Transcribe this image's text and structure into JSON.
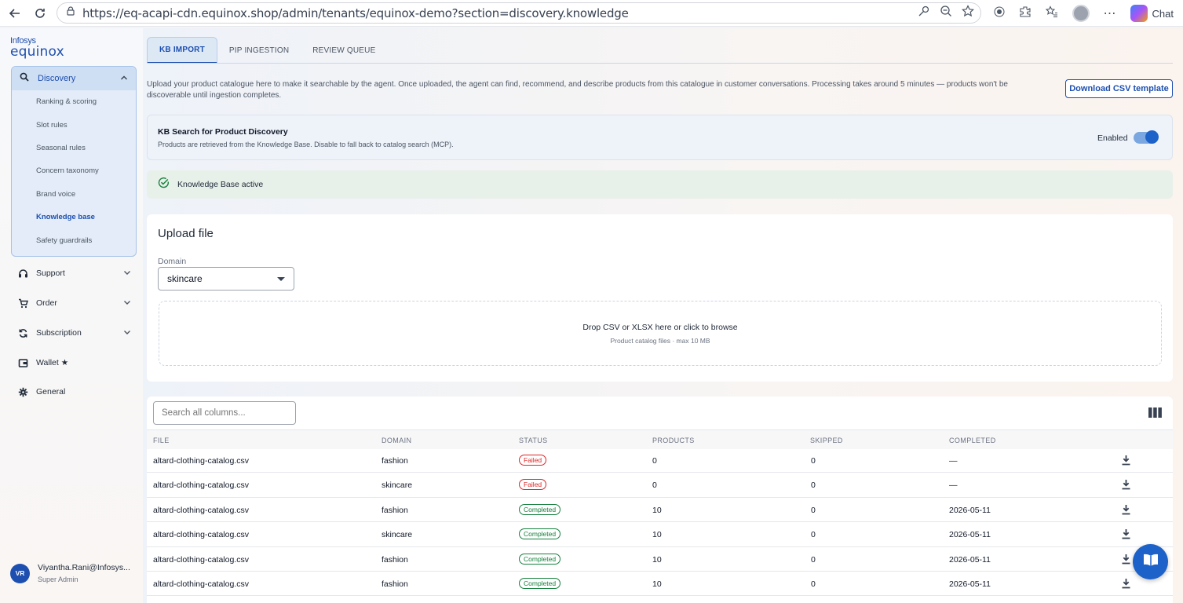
{
  "browser": {
    "url": "https://eq-acapi-cdn.equinox.shop/admin/tenants/equinox-demo?section=discovery.knowledge",
    "chat_label": "Chat"
  },
  "logo": {
    "top": "Infosys",
    "main": "equinox"
  },
  "sidebar": {
    "discovery": {
      "label": "Discovery",
      "items": [
        {
          "label": "Ranking & scoring",
          "active": false
        },
        {
          "label": "Slot rules",
          "active": false
        },
        {
          "label": "Seasonal rules",
          "active": false
        },
        {
          "label": "Concern taxonomy",
          "active": false
        },
        {
          "label": "Brand voice",
          "active": false
        },
        {
          "label": "Knowledge base",
          "active": true
        },
        {
          "label": "Safety guardrails",
          "active": false
        }
      ]
    },
    "nav": [
      {
        "label": "Support",
        "icon": "headset-icon"
      },
      {
        "label": "Order",
        "icon": "cart-icon"
      },
      {
        "label": "Subscription",
        "icon": "refresh-icon"
      },
      {
        "label": "Wallet ★",
        "icon": "wallet-icon"
      },
      {
        "label": "General",
        "icon": "gear-icon"
      }
    ],
    "user": {
      "initials": "VR",
      "name": "Viyantha.Rani@Infosys...",
      "role": "Super Admin"
    }
  },
  "tabs": [
    {
      "label": "KB IMPORT",
      "active": true
    },
    {
      "label": "PIP INGESTION",
      "active": false
    },
    {
      "label": "REVIEW QUEUE",
      "active": false
    }
  ],
  "intro": "Upload your product catalogue here to make it searchable by the agent. Once uploaded, the agent can find, recommend, and describe products from this catalogue in customer conversations. Processing takes around 5 minutes — products won't be discoverable until ingestion completes.",
  "download_csv_label": "Download CSV template",
  "kb_search": {
    "title": "KB Search for Product Discovery",
    "description": "Products are retrieved from the Knowledge Base. Disable to fall back to catalog search (MCP).",
    "toggle_label": "Enabled",
    "enabled": true
  },
  "kb_status": "Knowledge Base active",
  "upload": {
    "title": "Upload file",
    "domain_label": "Domain",
    "domain_value": "skincare",
    "drop_main": "Drop CSV or XLSX here or click to browse",
    "drop_sub": "Product catalog files · max 10 MB"
  },
  "table": {
    "search_placeholder": "Search all columns...",
    "headers": [
      "FILE",
      "DOMAIN",
      "STATUS",
      "PRODUCTS",
      "SKIPPED",
      "COMPLETED"
    ],
    "rows": [
      {
        "file": "altard-clothing-catalog.csv",
        "domain": "fashion",
        "status": "Failed",
        "products": "0",
        "skipped": "0",
        "completed": "—"
      },
      {
        "file": "altard-clothing-catalog.csv",
        "domain": "skincare",
        "status": "Failed",
        "products": "0",
        "skipped": "0",
        "completed": "—"
      },
      {
        "file": "altard-clothing-catalog.csv",
        "domain": "fashion",
        "status": "Completed",
        "products": "10",
        "skipped": "0",
        "completed": "2026-05-11"
      },
      {
        "file": "altard-clothing-catalog.csv",
        "domain": "skincare",
        "status": "Completed",
        "products": "10",
        "skipped": "0",
        "completed": "2026-05-11"
      },
      {
        "file": "altard-clothing-catalog.csv",
        "domain": "fashion",
        "status": "Completed",
        "products": "10",
        "skipped": "0",
        "completed": "2026-05-11"
      },
      {
        "file": "altard-clothing-catalog.csv",
        "domain": "fashion",
        "status": "Completed",
        "products": "10",
        "skipped": "0",
        "completed": "2026-05-11"
      }
    ]
  },
  "colors": {
    "accent": "#1d4fb0",
    "failed": "#dc2626",
    "completed": "#15803d"
  }
}
